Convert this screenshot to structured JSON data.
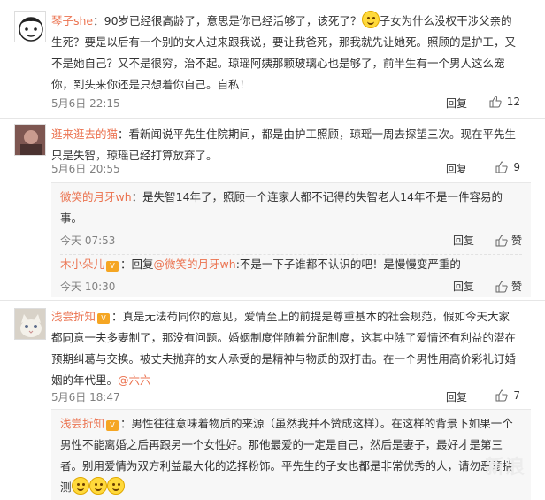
{
  "comments": [
    {
      "user": "琴子she",
      "text_a": "：90岁已经很高龄了，意思是你已经活够了，该死了？",
      "text_b": "子女为什么没权干涉父亲的生死？要是以后有一个别的女人过来跟我说，要让我爸死，那我就先让她死。照顾的是护工，又不是她自己？又不是很穷，治不起。琼瑶阿姨那颗玻璃心也是够了，前半生有一个男人这么宠你，到头来你还是只想着你自己。自私！",
      "time": "5月6日 22:15",
      "reply": "回复",
      "likes": "12"
    },
    {
      "user": "逛来逛去的猫",
      "text": "：看新闻说平先生住院期间，都是由护工照顾，琼瑶一周去探望三次。现在平先生只是失智，琼瑶已经打算放弃了。",
      "time": "5月6日 20:55",
      "reply": "回复",
      "likes": "9",
      "subs": [
        {
          "user": "微笑的月牙wh",
          "text": "：是失智14年了，照顾一个连家人都不记得的失智老人14年不是一件容易的事。",
          "time": "今天 07:53",
          "reply": "回复",
          "likes": "赞"
        },
        {
          "user": "木小朵儿",
          "text_pre": "：回复",
          "mention": "@微笑的月牙wh",
          "text_post": ":不是一下子谁都不认识的吧！是慢慢变严重的",
          "time": "今天 10:30",
          "reply": "回复",
          "likes": "赞"
        }
      ]
    },
    {
      "user": "浅尝折知",
      "text": "：真是无法苟同你的意见，爱情至上的前提是尊重基本的社会规范，假如今天大家都同意一夫多妻制了，那没有问题。婚姻制度伴随着分配制度，这其中除了爱情还有利益的潜在预期纠葛与交换。被丈夫抛弃的女人承受的是精神与物质的双打击。在一个男性用高价彩礼订婚姻的年代里。",
      "mention": "@六六",
      "time": "5月6日 18:47",
      "reply": "回复",
      "likes": "7",
      "subs": [
        {
          "user": "浅尝折知",
          "text": "：男性往往意味着物质的来源（虽然我并不赞成这样）。在这样的背景下如果一个男性不能离婚之后再跟另一个女性好。那他最爱的一定是自己，然后是妻子，最好才是第三者。别用爱情为双方利益最大化的选择粉饰。平先生的子女也都是非常优秀的人，请勿恶意揣测"
        }
      ]
    }
  ],
  "vip_badge": "V",
  "watermark": "新浪"
}
